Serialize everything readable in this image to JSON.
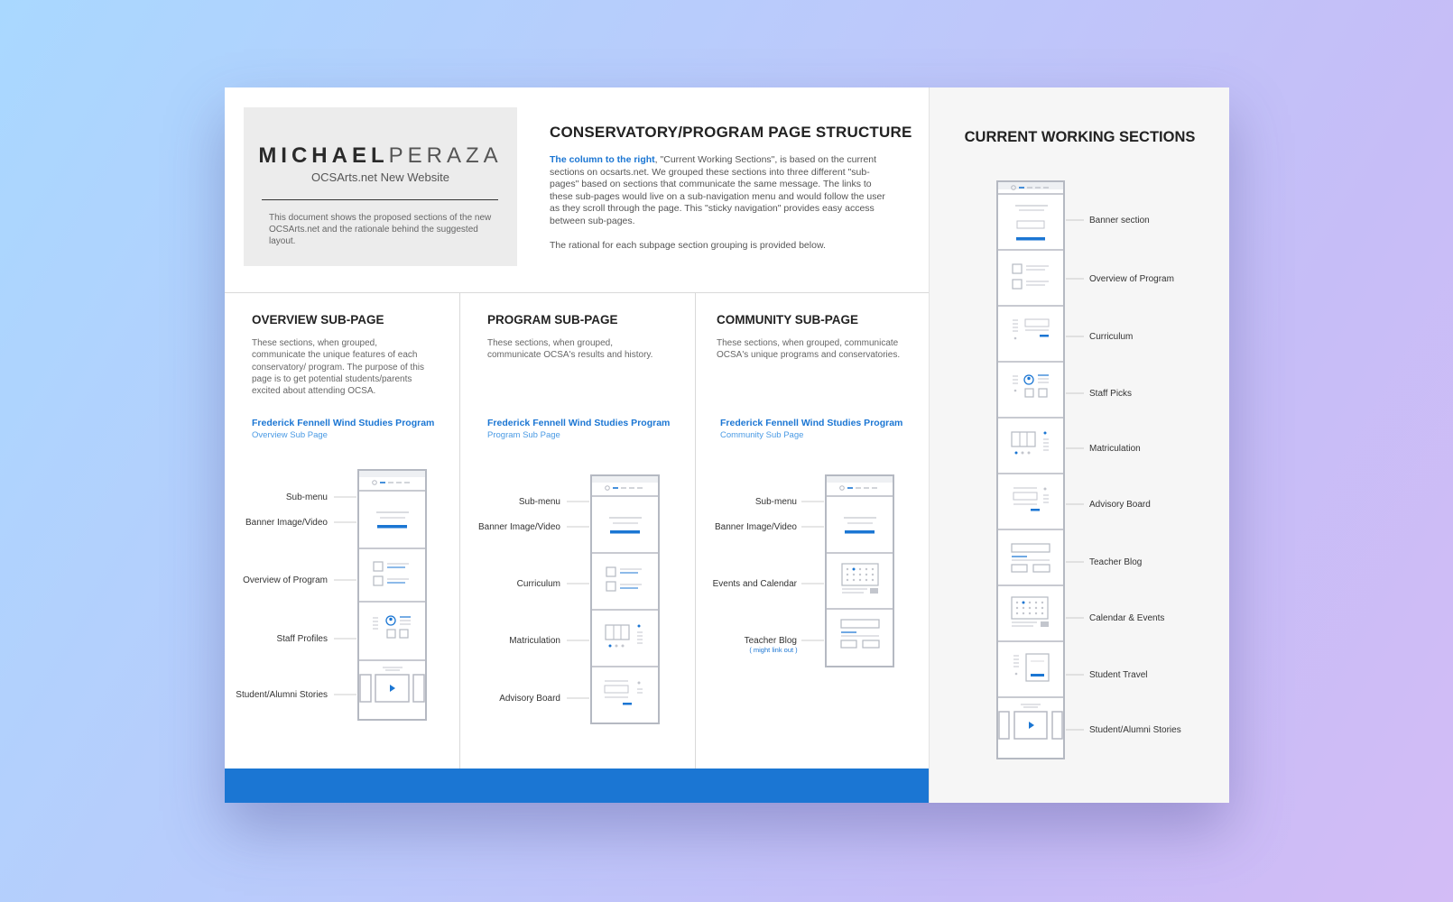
{
  "brand": {
    "name_bold": "MICHAEL",
    "name_light": "PERAZA",
    "subtitle": "OCSArts.net New Website",
    "description": "This document shows the proposed sections of the new OCSArts.net and the rationale behind the suggested layout."
  },
  "header": {
    "title": "CONSERVATORY/PROGRAM PAGE STRUCTURE",
    "intro_highlight": "The column to the right",
    "intro_body": ", \"Current Working Sections\", is based on the current sections on ocsarts.net. We grouped these sections into three different \"sub-pages\" based on sections that communicate the same message. The links to these sub-pages would live on a sub-navigation menu and would follow the user as they scroll through the page. This \"sticky navigation\" provides easy access between sub-pages.",
    "intro_rationale": "The rational for each subpage section grouping is provided below."
  },
  "columns": [
    {
      "title": "OVERVIEW SUB-PAGE",
      "description": "These sections, when grouped, communicate the unique features of each conservatory/ program. The purpose of this page is to get potential students/parents excited about attending OCSA.",
      "link": "Frederick Fennell Wind Studies Program",
      "link_sub": "Overview Sub Page",
      "labels": [
        "Sub-menu",
        "Banner Image/Video",
        "Overview of Program",
        "Staff Profiles",
        "Student/Alumni Stories"
      ]
    },
    {
      "title": "PROGRAM SUB-PAGE",
      "description": "These sections, when grouped, communicate OCSA's results and history.",
      "link": "Frederick Fennell Wind Studies Program",
      "link_sub": "Program Sub Page",
      "labels": [
        "Sub-menu",
        "Banner Image/Video",
        "Curriculum",
        "Matriculation",
        "Advisory Board"
      ]
    },
    {
      "title": "COMMUNITY SUB-PAGE",
      "description": "These sections, when grouped, communicate OCSA's unique programs and conservatories.",
      "link": "Frederick Fennell Wind Studies Program",
      "link_sub": "Community Sub Page",
      "labels": [
        "Sub-menu",
        "Banner Image/Video",
        "Events and Calendar",
        "Teacher Blog"
      ],
      "note": "( might link out )"
    }
  ],
  "current_sections": {
    "title": "CURRENT WORKING SECTIONS",
    "items": [
      "Banner section",
      "Overview of Program",
      "Curriculum",
      "Staff Picks",
      "Matriculation",
      "Advisory Board",
      "Teacher Blog",
      "Calendar & Events",
      "Student Travel",
      "Student/Alumni Stories"
    ]
  },
  "colors": {
    "accent": "#1b76d3",
    "wireframe": "#b5b9c2",
    "text": "#333333"
  }
}
